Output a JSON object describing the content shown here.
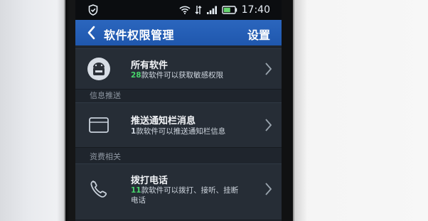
{
  "status_bar": {
    "time": "17:40"
  },
  "header": {
    "title": "软件权限管理",
    "settings_label": "设置"
  },
  "rows": [
    {
      "label": "所有软件",
      "sub_count": "28",
      "sub_text": "款软件可以获取敏感权限"
    },
    {
      "section": "信息推送",
      "label": "推送通知栏消息",
      "sub_count": "1",
      "sub_text": "款软件可以推送通知栏信息"
    },
    {
      "section": "资费相关",
      "label": "拨打电话",
      "sub_count": "11",
      "sub_text": "款软件可以拨打、接听、挂断",
      "sub_text_line2": "电话"
    }
  ],
  "colors": {
    "accent": "#2260b6",
    "count_green": "#47d46b"
  }
}
